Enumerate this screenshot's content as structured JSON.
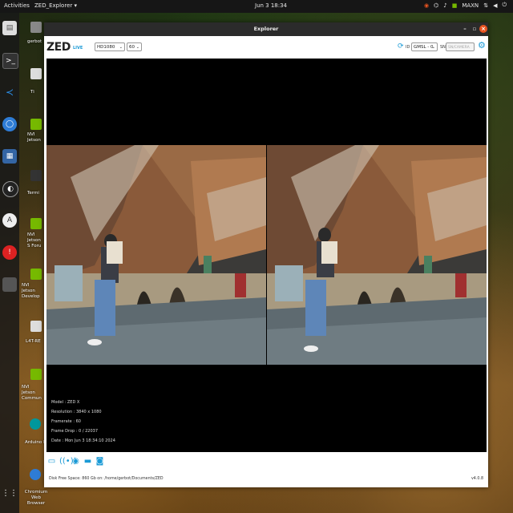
{
  "topbar": {
    "activities": "Activities",
    "app_menu": "ZED_Explorer ▾",
    "clock": "Jun 3 18:34",
    "tray_label": "MAXN"
  },
  "desktop": {
    "labels": [
      "gerbot",
      "Ti",
      "NVI Jetson",
      "Termi",
      "NVI Jetson S Foru",
      "NVI Jetson Develop",
      "L4T-RE",
      "NVI Jetson Commun",
      "Arduino IDE",
      "Chromium Web Browser"
    ]
  },
  "window": {
    "title": "Explorer",
    "minimize": "–",
    "maximize": "▫",
    "close": "×"
  },
  "toolbar": {
    "logo": "ZED",
    "live": "LIVE",
    "resolution": "HD1080",
    "fps": "60",
    "id_label": "ID",
    "id_value": "GMSL - 0",
    "sn_label": "SN",
    "sn_placeholder": "SN/CAMERA"
  },
  "info": {
    "model": "Model : ZED X",
    "resolution": "Resolution : 3840 x 1080",
    "framerate": "Framerate : 60",
    "frame_drop": "Frame Drop : 0 / 22037",
    "date": "Date : Mon Jun 3 18:34:10 2024"
  },
  "bottom": {
    "status": "Disk Free Space: 860 Gb  on: /home/gerbot/Documents/ZED",
    "version": "v4.0.8"
  },
  "colors": {
    "accent": "#1a9ad6",
    "close": "#e95420"
  },
  "icons": [
    "folder-icon",
    "broadcast-icon",
    "recorder-icon",
    "svo-icon",
    "camera-icon"
  ]
}
